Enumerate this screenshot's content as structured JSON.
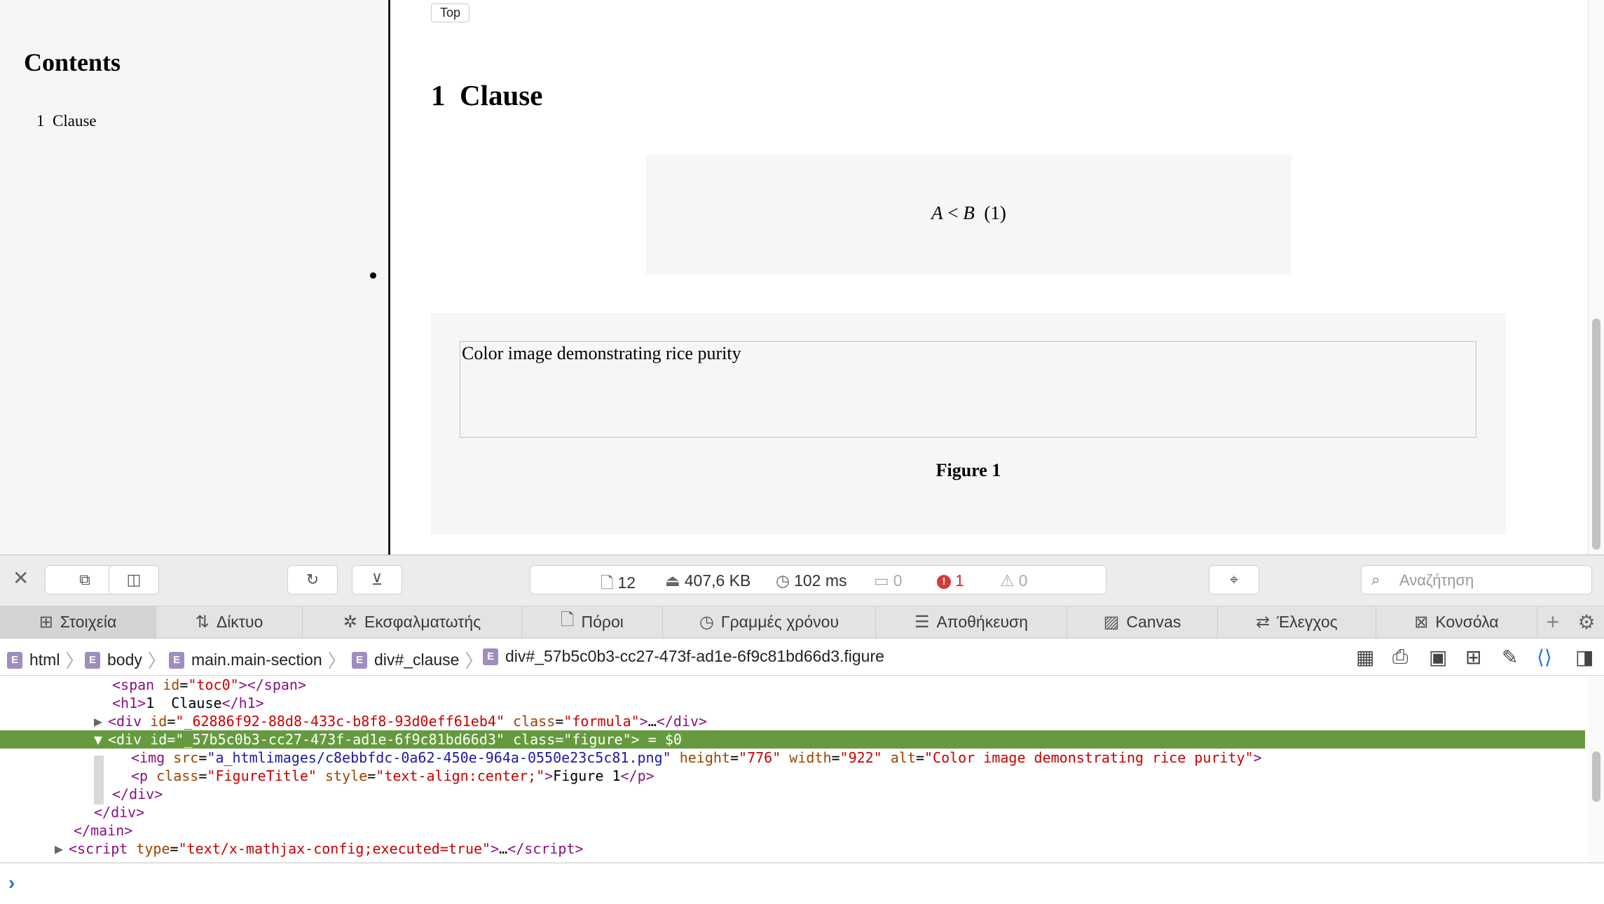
{
  "page": {
    "toc": {
      "title": "Contents",
      "items": [
        {
          "label": "1  Clause"
        }
      ]
    },
    "top_button": "Top",
    "heading": "1  Clause",
    "formula": {
      "a": "A",
      "op": "<",
      "b": "B",
      "number": "(1)"
    },
    "figure": {
      "alt_text": "Color image demonstrating rice purity",
      "title": "Figure 1"
    }
  },
  "inspector": {
    "stats": {
      "resources": "12",
      "size": "407,6 KB",
      "time": "102 ms",
      "messages": "0",
      "errors": "1",
      "warnings": "0"
    },
    "search": {
      "placeholder": "Αναζήτηση"
    },
    "tabs": [
      {
        "label": "Στοιχεία",
        "icon": "elements-icon",
        "active": true
      },
      {
        "label": "Δίκτυο",
        "icon": "network-icon"
      },
      {
        "label": "Εκσφαλματωτής",
        "icon": "debugger-icon"
      },
      {
        "label": "Πόροι",
        "icon": "resources-icon"
      },
      {
        "label": "Γραμμές χρόνου",
        "icon": "timelines-icon"
      },
      {
        "label": "Αποθήκευση",
        "icon": "storage-icon"
      },
      {
        "label": "Canvas",
        "icon": "canvas-icon"
      },
      {
        "label": "Έλεγχος",
        "icon": "audit-icon"
      },
      {
        "label": "Κονσόλα",
        "icon": "console-icon"
      }
    ],
    "breadcrumb": [
      "html",
      "body",
      "main.main-section",
      "div#_clause",
      "div#_57b5c0b3-cc27-473f-ad1e-6f9c81bd66d3.figure"
    ],
    "dom": {
      "span_id": "toc0",
      "h1_text": "1  Clause",
      "formula_div_id": "_62886f92-88d8-433c-b8f8-93d0eff61eb4",
      "formula_div_class": "formula",
      "figure_div_id": "_57b5c0b3-cc27-473f-ad1e-6f9c81bd66d3",
      "figure_div_class": "figure",
      "selected_marker": "= $0",
      "img_src": "a_htmlimages/c8ebbfdc-0a62-450e-964a-0550e23c5c81.png",
      "img_height": "776",
      "img_width": "922",
      "img_alt": "Color image demonstrating rice purity",
      "p_class": "FigureTitle",
      "p_style": "text-align:center;",
      "p_text": "Figure 1",
      "script_type": "text/x-mathjax-config;executed=true"
    }
  }
}
